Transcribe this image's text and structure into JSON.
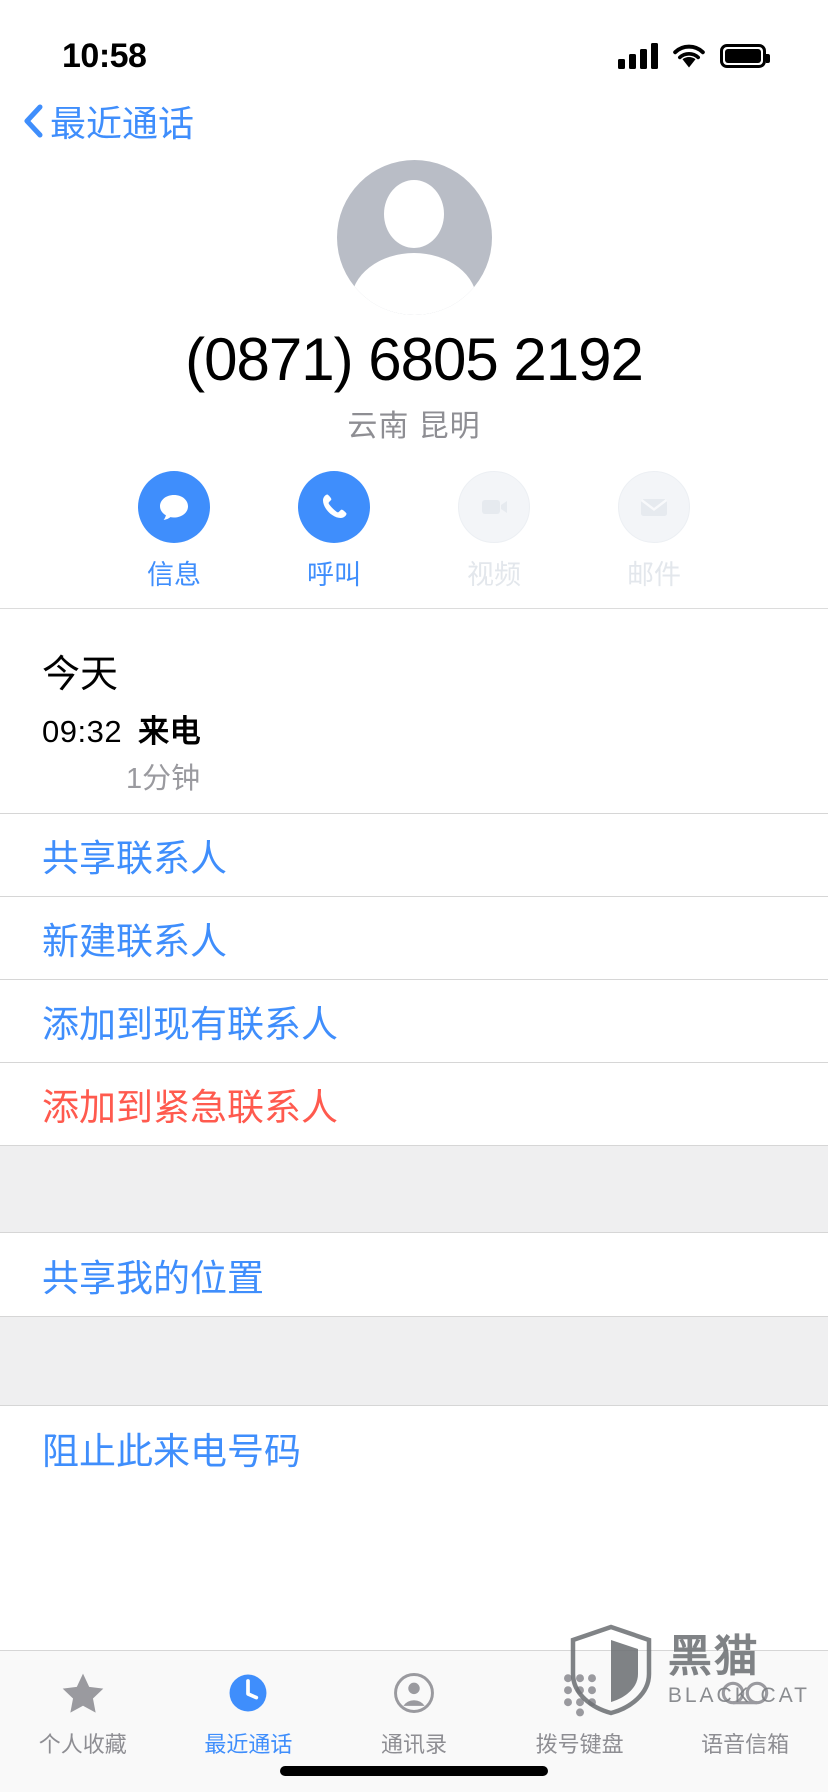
{
  "status_bar": {
    "time": "10:58",
    "signal_icon": "cellular-signal-icon",
    "wifi_icon": "wifi-icon",
    "battery_icon": "battery-full-icon"
  },
  "nav": {
    "back_icon": "chevron-left-icon",
    "back_label": "最近通话"
  },
  "contact": {
    "avatar_icon": "person-placeholder-avatar",
    "phone_number": "(0871) 6805 2192",
    "location": "云南 昆明"
  },
  "actions": [
    {
      "label": "信息",
      "icon": "message-bubble-icon",
      "enabled": true
    },
    {
      "label": "呼叫",
      "icon": "phone-handset-icon",
      "enabled": true
    },
    {
      "label": "视频",
      "icon": "video-camera-icon",
      "enabled": false
    },
    {
      "label": "邮件",
      "icon": "mail-envelope-icon",
      "enabled": false
    }
  ],
  "history": {
    "section_title": "今天",
    "entry": {
      "time": "09:32",
      "kind": "来电",
      "duration": "1分钟"
    }
  },
  "menu_group_1": [
    {
      "label": "共享联系人",
      "style": "normal"
    },
    {
      "label": "新建联系人",
      "style": "normal"
    },
    {
      "label": "添加到现有联系人",
      "style": "normal"
    },
    {
      "label": "添加到紧急联系人",
      "style": "danger"
    }
  ],
  "menu_group_2": [
    {
      "label": "共享我的位置",
      "style": "normal"
    }
  ],
  "menu_group_3": [
    {
      "label": "阻止此来电号码",
      "style": "normal"
    }
  ],
  "tabbar": [
    {
      "label": "个人收藏",
      "icon": "star-icon",
      "active": false
    },
    {
      "label": "最近通话",
      "icon": "clock-icon",
      "active": true
    },
    {
      "label": "通讯录",
      "icon": "person-circle-icon",
      "active": false
    },
    {
      "label": "拨号键盘",
      "icon": "keypad-icon",
      "active": false
    },
    {
      "label": "语音信箱",
      "icon": "voicemail-icon",
      "active": false
    }
  ],
  "watermark": {
    "shield_icon": "shield-cat-icon",
    "cn": "黑猫",
    "en": "BLACK CAT"
  },
  "colors": {
    "accent_blue": "#3f8efc",
    "danger_red": "#ff5a4e",
    "muted_gray": "#8e8e93",
    "group_bg": "#efeff0"
  }
}
